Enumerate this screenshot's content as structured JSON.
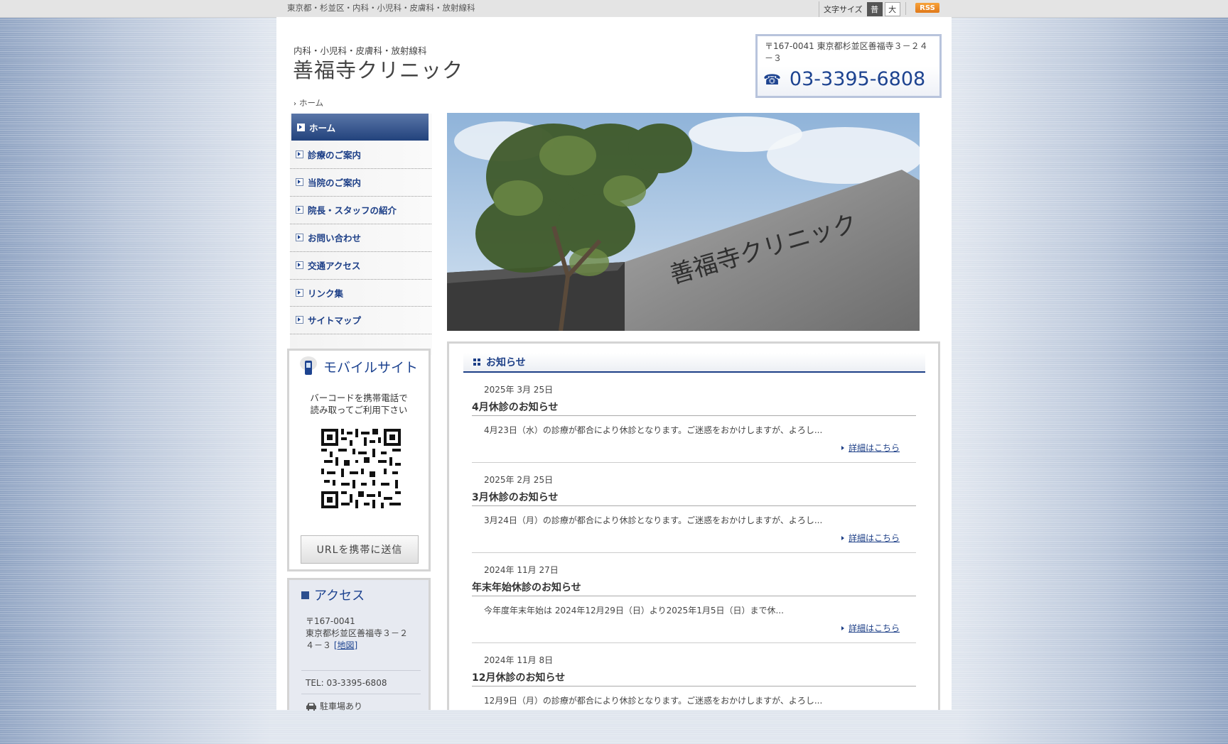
{
  "topbar": {
    "tagline": "東京都・杉並区・内科・小児科・皮膚科・放射線科",
    "fontsize_label": "文字サイズ",
    "fontsize_normal": "普",
    "fontsize_large": "大",
    "rss": "RSS"
  },
  "header": {
    "subtitle": "内科・小児科・皮膚科・放射線科",
    "site_name": "善福寺クリニック",
    "contact_address": "〒167-0041 東京都杉並区善福寺３－２４－３",
    "contact_tel": "03-3395-6808"
  },
  "breadcrumb": {
    "home": "ホーム"
  },
  "nav": {
    "items": [
      "ホーム",
      "診療のご案内",
      "当院のご案内",
      "院長・スタッフの紹介",
      "お問い合わせ",
      "交通アクセス",
      "リンク集",
      "サイトマップ"
    ]
  },
  "hero": {
    "sign_text": "善福寺クリニック"
  },
  "mobile": {
    "title": "モバイルサイト",
    "desc1": "バーコードを携帯電話で",
    "desc2": "読み取ってご利用下さい",
    "send_button": "URLを携帯に送信"
  },
  "access": {
    "title": "アクセス",
    "postal": "〒167-0041",
    "address": "東京都杉並区善福寺３－２４－３",
    "map_link": "[地図]",
    "tel": "TEL: 03-3395-6808",
    "parking": "駐車場あり"
  },
  "news": {
    "title": "お知らせ",
    "more_label": "詳細はこちら",
    "entries": [
      {
        "date": "2025年 3月 25日",
        "title": "4月休診のお知らせ",
        "body": "4月23日（水）の診療が都合により休診となります。ご迷惑をおかけしますが、よろし..."
      },
      {
        "date": "2025年 2月 25日",
        "title": "3月休診のお知らせ",
        "body": "3月24日（月）の診療が都合により休診となります。ご迷惑をおかけしますが、よろし..."
      },
      {
        "date": "2024年 11月 27日",
        "title": "年末年始休診のお知らせ",
        "body": "今年度年末年始は 2024年12月29日（日）より2025年1月5日（日）まで休..."
      },
      {
        "date": "2024年 11月 8日",
        "title": "12月休診のお知らせ",
        "body": "12月9日（月）の診療が都合により休診となります。ご迷惑をおかけしますが、よろし..."
      }
    ]
  },
  "colors": {
    "brand_navy": "#1d3f87",
    "rss_orange": "#f08a24"
  }
}
